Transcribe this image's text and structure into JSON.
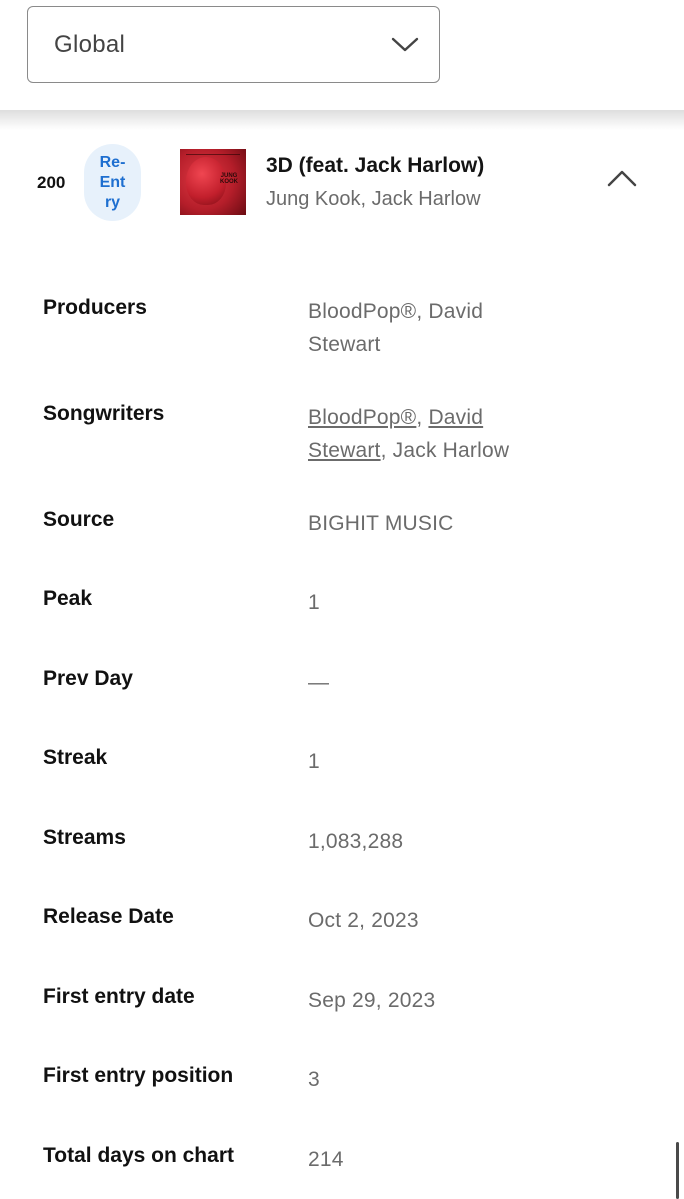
{
  "region_select": {
    "value": "Global",
    "icon": "chevron-down-icon"
  },
  "track": {
    "rank": "200",
    "badge": [
      "Re-",
      "Ent",
      "ry"
    ],
    "title": "3D (feat. Jack Harlow)",
    "artists": "Jung Kook, Jack Harlow",
    "cover": {
      "text": "JUNG KOOK",
      "colors": [
        "#e03a44",
        "#b51e2a"
      ]
    },
    "toggle_icon": "chevron-up-icon"
  },
  "details": {
    "producers": {
      "label": "Producers",
      "value": "BloodPop®, David Stewart"
    },
    "songwriters": {
      "label": "Songwriters",
      "link1": "BloodPop®",
      "sep1": ", ",
      "link2": "David Stewart",
      "sep2": ", ",
      "plain": "Jack Harlow"
    },
    "source": {
      "label": "Source",
      "value": "BIGHIT MUSIC"
    },
    "peak": {
      "label": "Peak",
      "value": "1"
    },
    "prev_day": {
      "label": "Prev Day",
      "value": "—"
    },
    "streak": {
      "label": "Streak",
      "value": "1"
    },
    "streams": {
      "label": "Streams",
      "value": "1,083,288"
    },
    "release_date": {
      "label": "Release Date",
      "value": "Oct 2, 2023"
    },
    "first_entry_date": {
      "label": "First entry date",
      "value": "Sep 29, 2023"
    },
    "first_entry_position": {
      "label": "First entry position",
      "value": "3"
    },
    "total_days": {
      "label": "Total days on chart",
      "value": "214"
    }
  },
  "colors": {
    "badge_text": "#1e6fd0",
    "badge_bg": "#e7f1fb",
    "value_text": "#6b6b6b"
  }
}
